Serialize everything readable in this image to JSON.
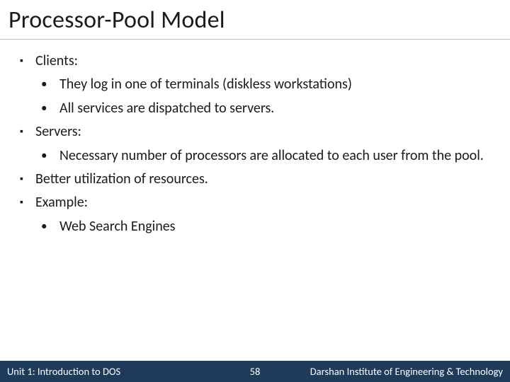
{
  "title": "Processor-Pool Model",
  "bullets": {
    "clients": "Clients:",
    "clients_sub1": "They log in one of terminals (diskless workstations)",
    "clients_sub2": "All services are dispatched to servers.",
    "servers": "Servers:",
    "servers_sub1": "Necessary number of processors are allocated to each user from the pool.",
    "better": "Better utilization of resources.",
    "example": "Example:",
    "example_sub1": "Web Search Engines"
  },
  "footer": {
    "left": "Unit 1: Introduction to DOS",
    "page": "58",
    "right": "Darshan Institute of Engineering & Technology"
  }
}
